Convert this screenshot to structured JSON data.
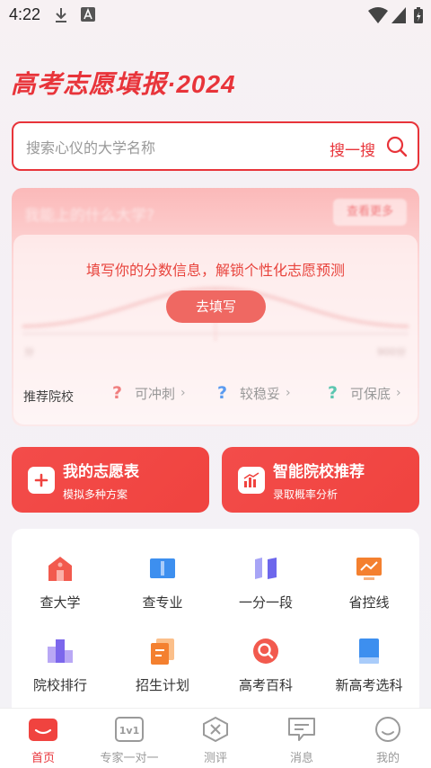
{
  "status_bar": {
    "time": "4:22"
  },
  "header": {
    "title": "高考志愿填报·2024"
  },
  "search": {
    "placeholder": "搜索心仪的大学名称",
    "button_label": "搜一搜"
  },
  "predict_card": {
    "header_text": "我能上的什么大学?",
    "header_pill": "查看更多",
    "hint": "填写你的分数信息，解锁个性化志愿预测",
    "button_label": "去填写",
    "chart_left_label": "分",
    "chart_right_label": "900分",
    "recommend_label": "推荐院校",
    "recommend_items": [
      {
        "label": "可冲刺",
        "color": "#f07f7f"
      },
      {
        "label": "较稳妥",
        "color": "#5a9bf0"
      },
      {
        "label": "可保底",
        "color": "#5cc6b0"
      }
    ]
  },
  "actions": [
    {
      "title": "我的志愿表",
      "subtitle": "模拟多种方案"
    },
    {
      "title": "智能院校推荐",
      "subtitle": "录取概率分析"
    }
  ],
  "grid": [
    {
      "label": "查大学",
      "icon": "university-icon"
    },
    {
      "label": "查专业",
      "icon": "book-icon"
    },
    {
      "label": "一分一段",
      "icon": "score-segment-icon"
    },
    {
      "label": "省控线",
      "icon": "trend-monitor-icon"
    },
    {
      "label": "院校排行",
      "icon": "ranking-icon"
    },
    {
      "label": "招生计划",
      "icon": "plan-document-icon"
    },
    {
      "label": "高考百科",
      "icon": "encyclopedia-search-icon"
    },
    {
      "label": "新高考选科",
      "icon": "subject-select-icon"
    }
  ],
  "bottom_nav": [
    {
      "label": "首页",
      "icon": "home-icon",
      "active": true
    },
    {
      "label": "专家一对一",
      "icon": "expert-1v1-icon",
      "active": false
    },
    {
      "label": "测评",
      "icon": "assessment-icon",
      "active": false
    },
    {
      "label": "消息",
      "icon": "message-icon",
      "active": false
    },
    {
      "label": "我的",
      "icon": "profile-icon",
      "active": false
    }
  ],
  "colors": {
    "brand": "#e8343a",
    "card_red": "#f0433f"
  }
}
